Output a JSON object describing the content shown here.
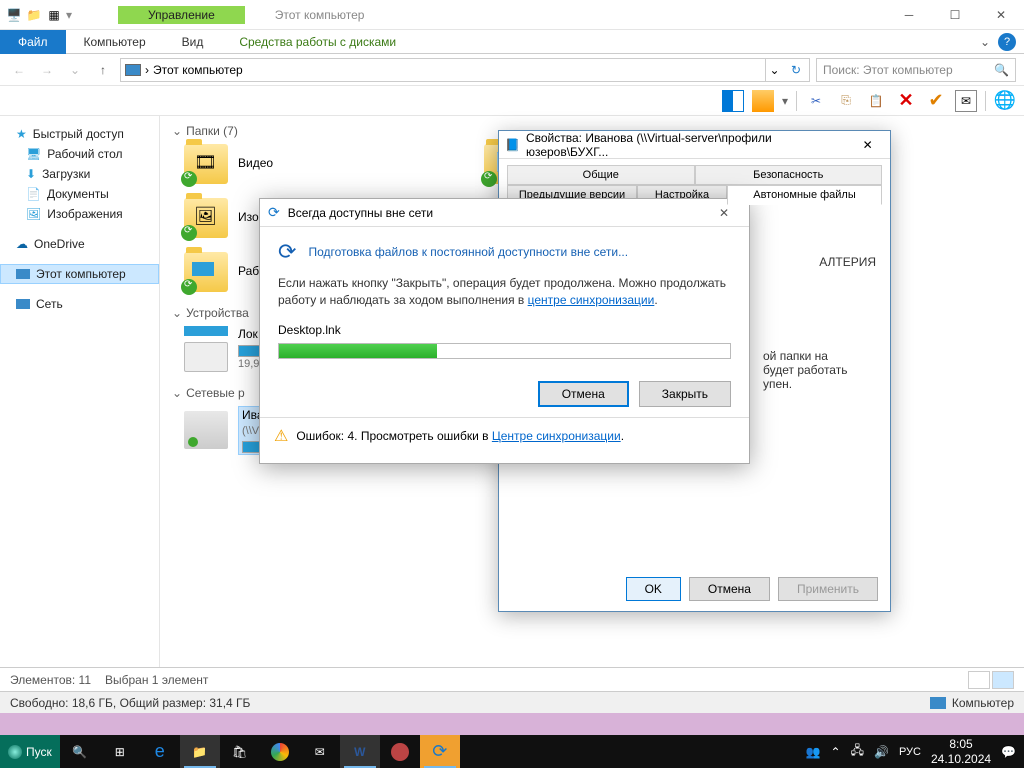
{
  "window": {
    "manage": "Управление",
    "title": "Этот компьютер"
  },
  "ribbon": {
    "file": "Файл",
    "computer": "Компьютер",
    "view": "Вид",
    "drivetools": "Средства работы с дисками"
  },
  "address": {
    "path": "Этот компьютер",
    "search_placeholder": "Поиск: Этот компьютер"
  },
  "sidebar": {
    "quick": "Быстрый доступ",
    "desktop": "Рабочий стол",
    "downloads": "Загрузки",
    "documents": "Документы",
    "pictures": "Изображения",
    "onedrive": "OneDrive",
    "thispc": "Этот компьютер",
    "network": "Сеть"
  },
  "sections": {
    "folders": "Папки (7)",
    "devices": "Устройства",
    "netloc": "Сетевые р"
  },
  "items": {
    "video": "Видео",
    "iz": "Изо",
    "rab": "Раб",
    "lok": "Лок",
    "loksub": "19,9",
    "iva": "Ива",
    "ivasub": "(\\\\V"
  },
  "status": {
    "elements": "Элементов: 11",
    "selected": "Выбран 1 элемент",
    "free": "Свободно: 18,6 ГБ, Общий размер: 31,4 ГБ",
    "computer": "Компьютер"
  },
  "propdlg": {
    "title": "Свойства: Иванова (\\\\Virtual-server\\профили юзеров\\БУХГ...",
    "tab_general": "Общие",
    "tab_security": "Безопасность",
    "tab_prev": "Предыдущие версии",
    "tab_settings": "Настройка",
    "tab_offline": "Автономные файлы",
    "body_frag": "АЛТЕРИЯ",
    "body_frag2": "ой папки на",
    "body_frag3": "будет работать",
    "body_frag4": "упен.",
    "ok": "OK",
    "cancel": "Отмена",
    "apply": "Применить"
  },
  "syncdlg": {
    "title": "Всегда доступны вне сети",
    "heading": "Подготовка файлов к постоянной доступности вне сети...",
    "text1": "Если нажать кнопку \"Закрыть\", операция будет продолжена.  Можно продолжать работу и наблюдать за ходом выполнения в ",
    "link1": "центре синхронизации",
    "file": "Desktop.lnk",
    "cancel": "Отмена",
    "close": "Закрыть",
    "err_prefix": "Ошибок: 4.  Просмотреть ошибки в ",
    "err_link": "Центре синхронизации"
  },
  "taskbar": {
    "start": "Пуск",
    "lang": "РУС",
    "time": "8:05",
    "date": "24.10.2024"
  }
}
